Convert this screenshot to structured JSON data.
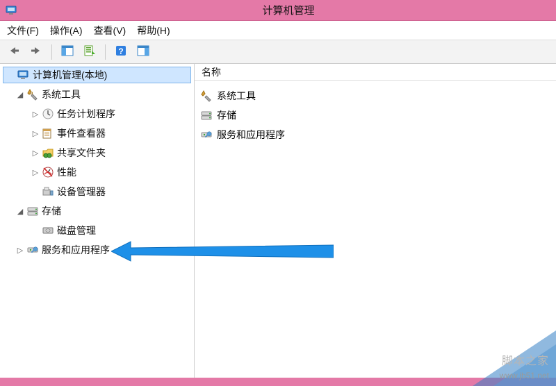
{
  "window": {
    "title": "计算机管理"
  },
  "menu": {
    "file": "文件(F)",
    "action": "操作(A)",
    "view": "查看(V)",
    "help": "帮助(H)"
  },
  "tree": {
    "root": "计算机管理(本地)",
    "system_tools": "系统工具",
    "task_scheduler": "任务计划程序",
    "event_viewer": "事件查看器",
    "shared_folders": "共享文件夹",
    "performance": "性能",
    "device_manager": "设备管理器",
    "storage": "存储",
    "disk_management": "磁盘管理",
    "services_apps": "服务和应用程序"
  },
  "list": {
    "column_name": "名称",
    "rows": {
      "system_tools": "系统工具",
      "storage": "存储",
      "services_apps": "服务和应用程序"
    }
  },
  "watermark": {
    "line1": "脚本之家",
    "line2": "www.jb51.net"
  }
}
